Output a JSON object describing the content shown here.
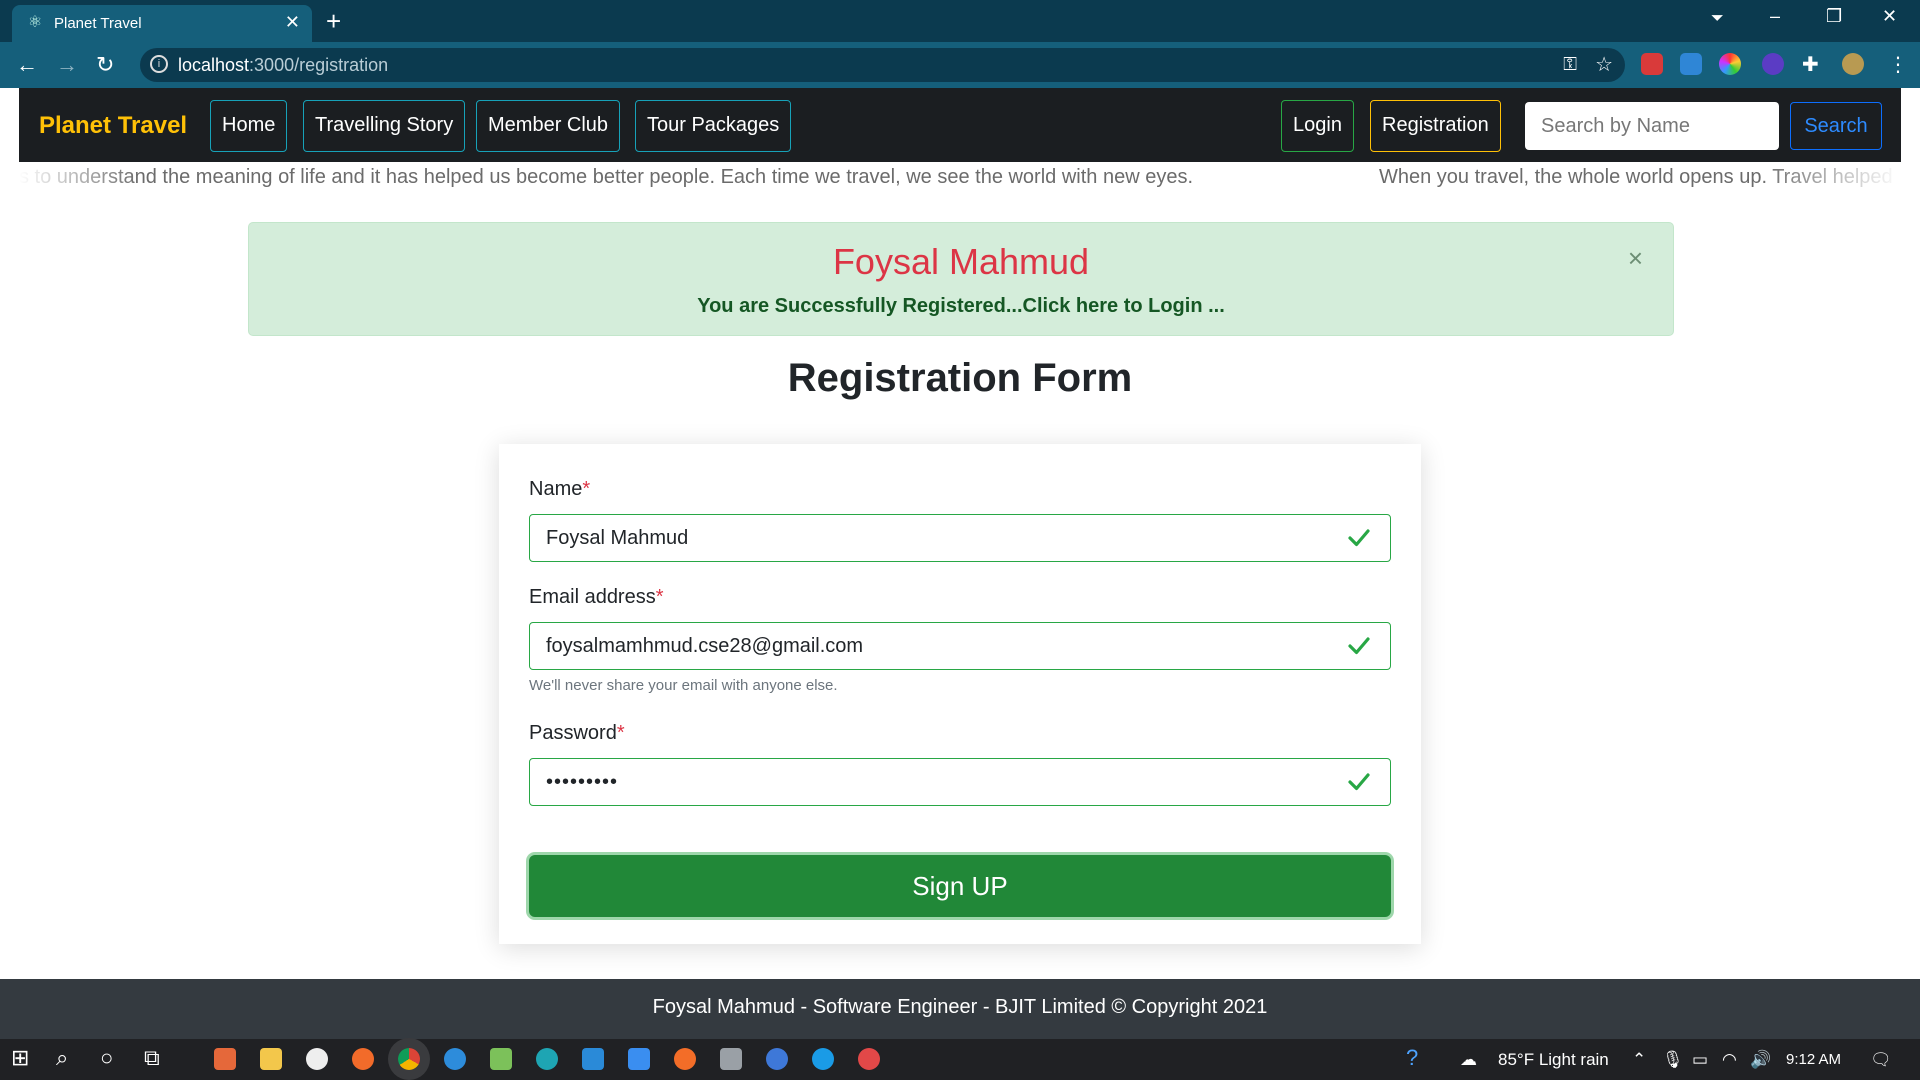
{
  "browser": {
    "tab_title": "Planet Travel",
    "url_host": "localhost",
    "url_rest": ":3000/registration"
  },
  "navbar": {
    "brand": "Planet Travel",
    "links": [
      "Home",
      "Travelling Story",
      "Member Club",
      "Tour Packages"
    ],
    "login": "Login",
    "registration": "Registration",
    "search_placeholder": "Search by Name",
    "search_button": "Search"
  },
  "marquee": {
    "text_1": "s to understand the meaning of life and it has helped us become better people. Each time we travel, we see the world with new eyes.",
    "text_2": "When you travel, the whole world opens up. Travel helped"
  },
  "alert": {
    "name": "Foysal Mahmud",
    "message": "You are Successfully Registered...Click here to Login ...",
    "close": "×"
  },
  "form": {
    "title": "Registration Form",
    "name_label": "Name",
    "name_value": "Foysal Mahmud",
    "email_label": "Email address",
    "email_value": "foysalmamhmud.cse28@gmail.com",
    "email_help": "We'll never share your email with anyone else.",
    "password_label": "Password",
    "password_value": "•••••••••",
    "required_mark": "*",
    "submit": "Sign UP"
  },
  "footer": {
    "text": "Foysal Mahmud - Software Engineer - BJIT Limited © Copyright 2021"
  },
  "taskbar": {
    "weather": "85°F  Light rain",
    "time": "9:12 AM"
  },
  "colors": {
    "brand": "#ffc107",
    "success": "#28a745",
    "danger": "#dc3545",
    "navbar_bg": "#1b1e21",
    "footer_bg": "#343a40"
  }
}
